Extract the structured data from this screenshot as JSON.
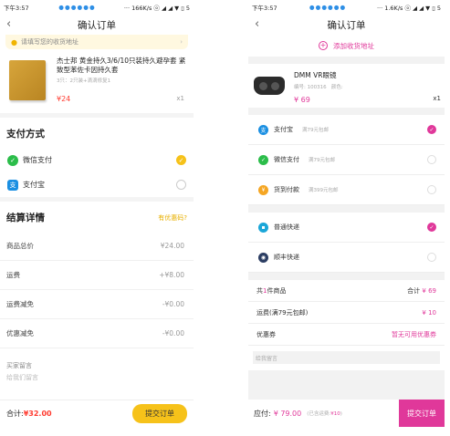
{
  "left": {
    "status": {
      "time": "下午3:57",
      "right": "··· 166K/s ⓞ ◢ ◢ ▼ ▯ 5"
    },
    "title": "确认订单",
    "address_prompt": "请填写您的收货地址",
    "product": {
      "name": "杰士邦 黄金持久3/6/10只装持久避孕套 紧致型苯佐卡因持久套",
      "sku": "3只：2只装+滴滴修复1",
      "price": "¥24",
      "qty": "x1"
    },
    "payment": {
      "title": "支付方式",
      "options": [
        {
          "label": "微信支付",
          "selected": true,
          "icon": "wechat-icon"
        },
        {
          "label": "支付宝",
          "selected": false,
          "icon": "alipay-icon"
        }
      ]
    },
    "details": {
      "title": "结算详情",
      "coupon_link": "有优惠码?",
      "rows": [
        {
          "label": "商品总价",
          "value": "¥24.00"
        },
        {
          "label": "运费",
          "value": "+¥8.00"
        },
        {
          "label": "运费减免",
          "value": "-¥0.00"
        },
        {
          "label": "优惠减免",
          "value": "-¥0.00"
        }
      ]
    },
    "message": {
      "label": "买家留言",
      "placeholder": "给我们留言"
    },
    "bottom": {
      "total_label": "合计:",
      "total_value": "¥32.00",
      "submit": "提交订单"
    },
    "accent": "#f6c21a"
  },
  "right": {
    "status": {
      "time": "下午3:57",
      "right": "··· 1.6K/s ⓞ ◢ ◢ ▼ ▯ 5"
    },
    "title": "确认订单",
    "add_address": "添加收货地址",
    "product": {
      "name": "DMM VR眼镜",
      "code": "编号: 100316",
      "color": "颜色:",
      "price": "¥ 69",
      "qty": "x1"
    },
    "payment_options": [
      {
        "label": "支付宝",
        "note": "满79元包邮",
        "selected": true,
        "icon": "alipay-icon",
        "color": "#1a8fe2"
      },
      {
        "label": "微信支付",
        "note": "满79元包邮",
        "selected": false,
        "icon": "wechat-icon",
        "color": "#2bbd4a"
      },
      {
        "label": "货到付款",
        "note": "满399元包邮",
        "selected": false,
        "icon": "cash-on-delivery-icon",
        "color": "#f5a623"
      }
    ],
    "shipping_options": [
      {
        "label": "普通快递",
        "selected": true,
        "icon": "express-icon",
        "color": "#1aa6d8"
      },
      {
        "label": "顺丰快递",
        "selected": false,
        "icon": "sf-express-icon",
        "color": "#2c3e63"
      }
    ],
    "summary": {
      "count_prefix": "共",
      "count": "1",
      "count_suffix": "件商品",
      "total_label": "合计",
      "total_value": "¥ 69",
      "shipping_label": "运费(满79元包邮)",
      "shipping_value": "¥ 10",
      "coupon_label": "优惠券",
      "coupon_value": "暂无可用优惠券"
    },
    "remark_placeholder": "给我留言",
    "bottom": {
      "pay_label": "应付:",
      "pay_value": "¥ 79.00",
      "ship_note_prefix": "(已含运费:",
      "ship_note_value": "¥10",
      "ship_note_suffix": ")",
      "submit": "提交订单"
    },
    "accent": "#e0389a"
  }
}
